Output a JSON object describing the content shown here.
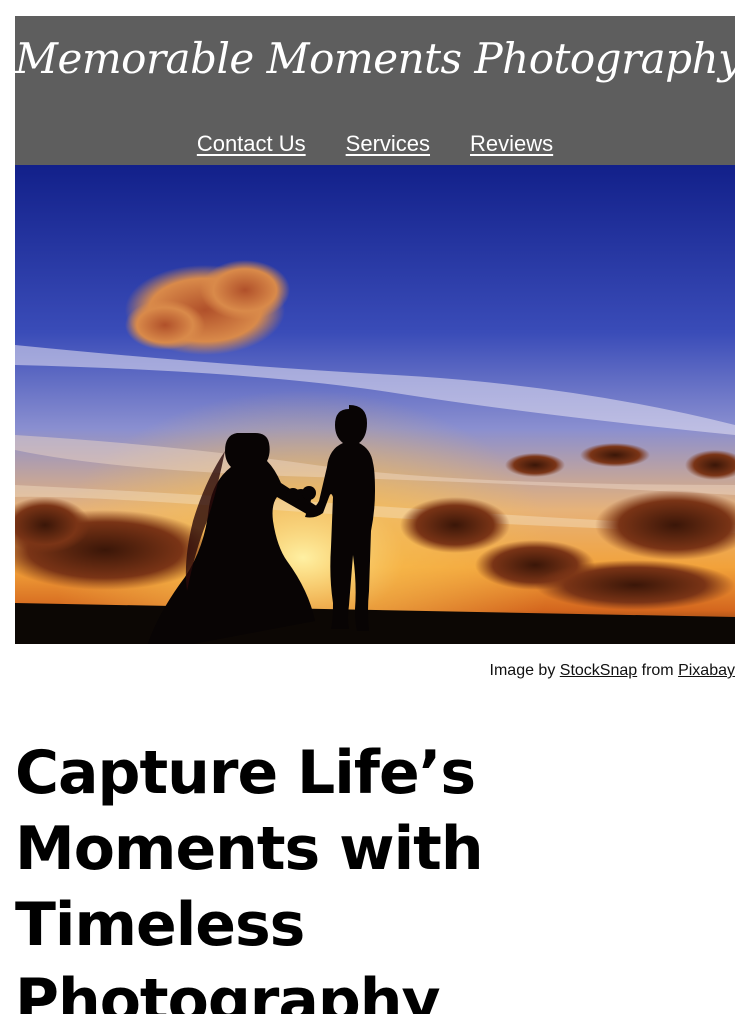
{
  "header": {
    "site_title": "Memorable Moments Photography",
    "background_color": "#5e5e5e",
    "nav": [
      {
        "label": "Contact Us"
      },
      {
        "label": "Services"
      },
      {
        "label": "Reviews"
      }
    ]
  },
  "hero": {
    "image_alt": "Silhouette of a bride and groom holding hands against a sunset sky"
  },
  "credit": {
    "prefix": "Image by",
    "author": "StockSnap",
    "middle": "from",
    "source": "Pixabay"
  },
  "main": {
    "headline": "Capture Life’s Moments with Timeless Photography"
  }
}
